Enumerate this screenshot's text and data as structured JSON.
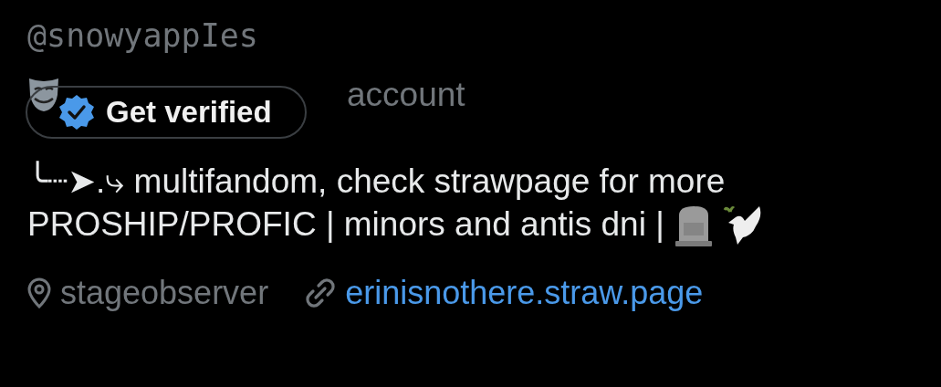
{
  "profile": {
    "handle": "@snowyappIes",
    "category": "account",
    "verify_button": "Get verified",
    "bio_lines": [
      "╰┈➤.⤷ multifandom, check strawpage for more",
      "PROSHIP/PROFIC | minors and antis dni |"
    ],
    "location": "stageobserver",
    "website": "erinisnothere.straw.page"
  }
}
